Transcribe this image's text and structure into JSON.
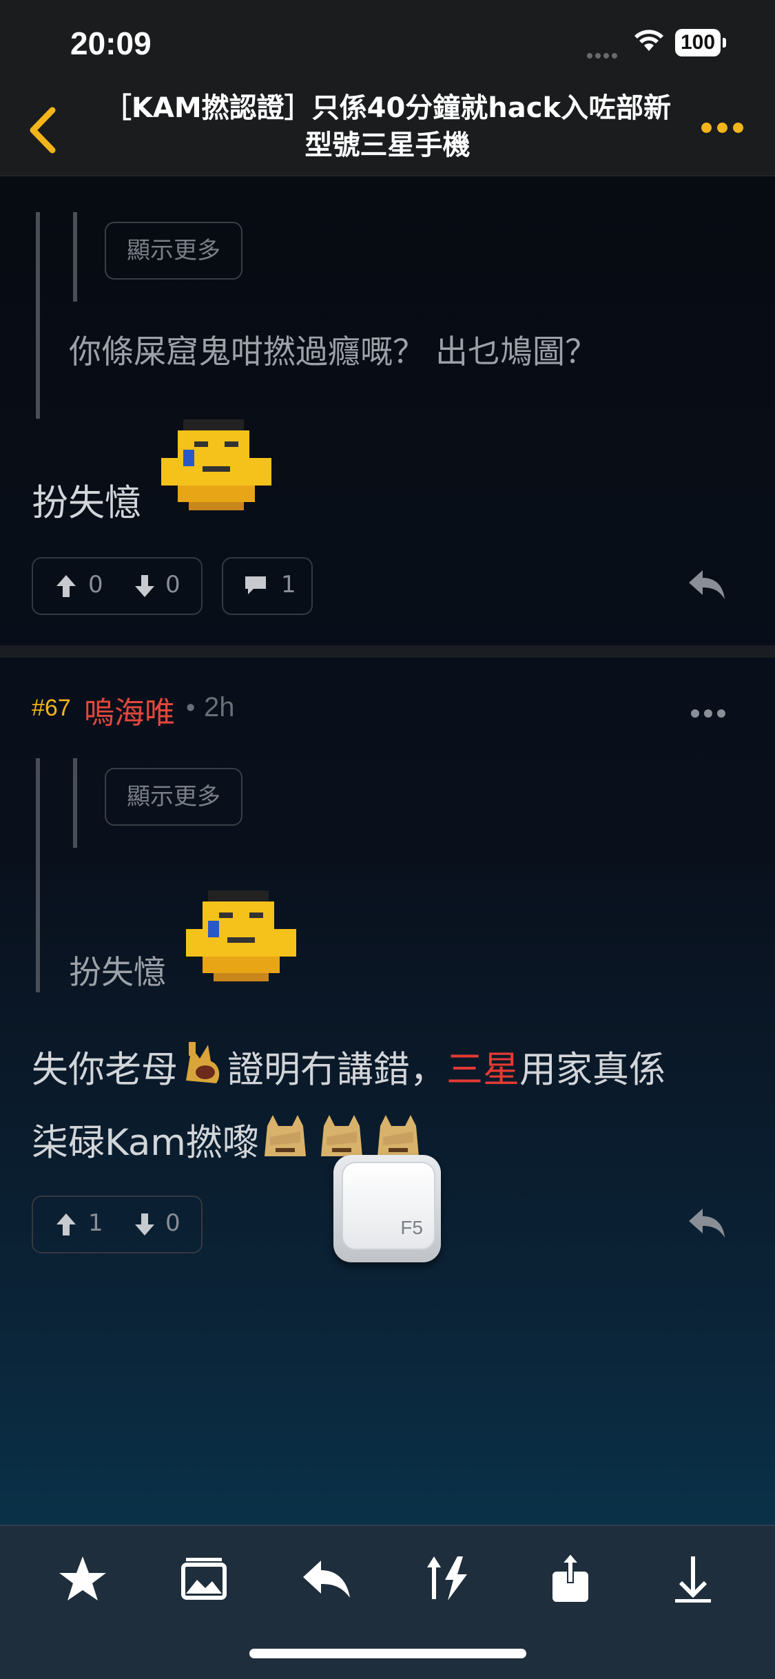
{
  "status": {
    "time": "20:09",
    "battery": "100"
  },
  "nav": {
    "title": "［KAM撚認證］只係40分鐘就hack入咗部新型號三星手機"
  },
  "post1": {
    "show_more": "顯示更多",
    "quote": "你條屎窟鬼咁撚過癮嘅？ 出乜鳩圖？",
    "text": "扮失憶",
    "upvotes": "0",
    "downvotes": "0",
    "comments": "1"
  },
  "post2": {
    "floor": "#67",
    "user": "嗚海唯",
    "time": "2h",
    "show_more": "顯示更多",
    "quote": "扮失憶",
    "text_part1": "失你老母",
    "text_part2": "證明冇講錯，",
    "text_highlight": "三星",
    "text_part3": "用家真係",
    "text_line2": "柒碌Kam撚嚟",
    "upvotes": "1",
    "downvotes": "0"
  },
  "refresh": {
    "label": "F5"
  },
  "colors": {
    "accent": "#f2b51a",
    "username": "#e4473c",
    "highlight": "#e43a33"
  },
  "icons": [
    "back-chevron-icon",
    "more-icon",
    "upvote-icon",
    "downvote-icon",
    "comment-icon",
    "reply-icon",
    "star-icon",
    "gallery-icon",
    "tab-reply-icon",
    "sort-icon",
    "share-icon",
    "download-icon"
  ]
}
